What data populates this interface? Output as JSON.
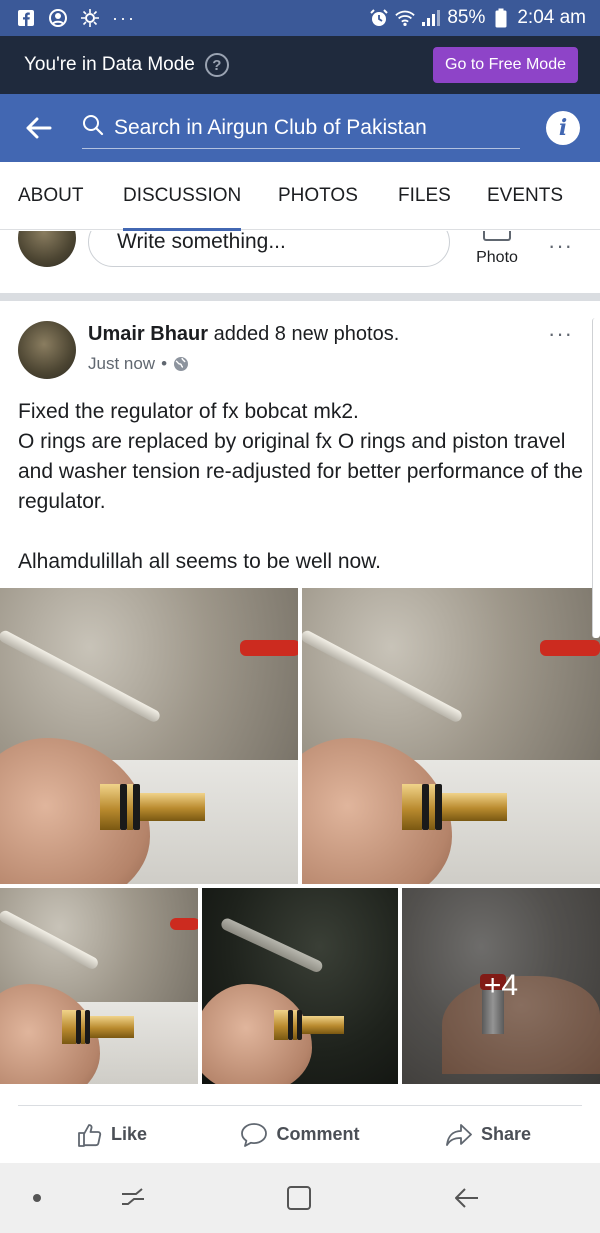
{
  "status_bar": {
    "battery_percent": "85%",
    "time": "2:04 am",
    "overflow": "···"
  },
  "data_mode": {
    "text": "You're in Data Mode",
    "help": "?",
    "button_label": "Go to Free Mode"
  },
  "search": {
    "placeholder": "Search in Airgun Club of Pakistan",
    "info": "i"
  },
  "tabs": [
    {
      "label": "ABOUT",
      "active": false
    },
    {
      "label": "DISCUSSION",
      "active": true
    },
    {
      "label": "PHOTOS",
      "active": false
    },
    {
      "label": "FILES",
      "active": false
    },
    {
      "label": "EVENTS",
      "active": false
    }
  ],
  "composer": {
    "placeholder": "Write something...",
    "photo_label": "Photo",
    "more": "···"
  },
  "post": {
    "author": "Umair Bhaur",
    "action": " added 8 new photos.",
    "time": "Just now",
    "privacy_icon": "globe-icon",
    "more": "···",
    "text_lines": [
      "Fixed the regulator of fx bobcat mk2.",
      "O rings are replaced by original fx O rings and piston travel and washer tension re-adjusted for better performance of the regulator.",
      "",
      "Alhamdulillah all seems to be well now."
    ],
    "photos_more": "+4"
  },
  "actions": {
    "like": "Like",
    "comment": "Comment",
    "share": "Share"
  },
  "colors": {
    "facebook_blue": "#4267b2",
    "status_bar": "#3b5998",
    "data_mode_bg": "#1f2a3d",
    "free_mode_btn": "#8e44c8"
  }
}
